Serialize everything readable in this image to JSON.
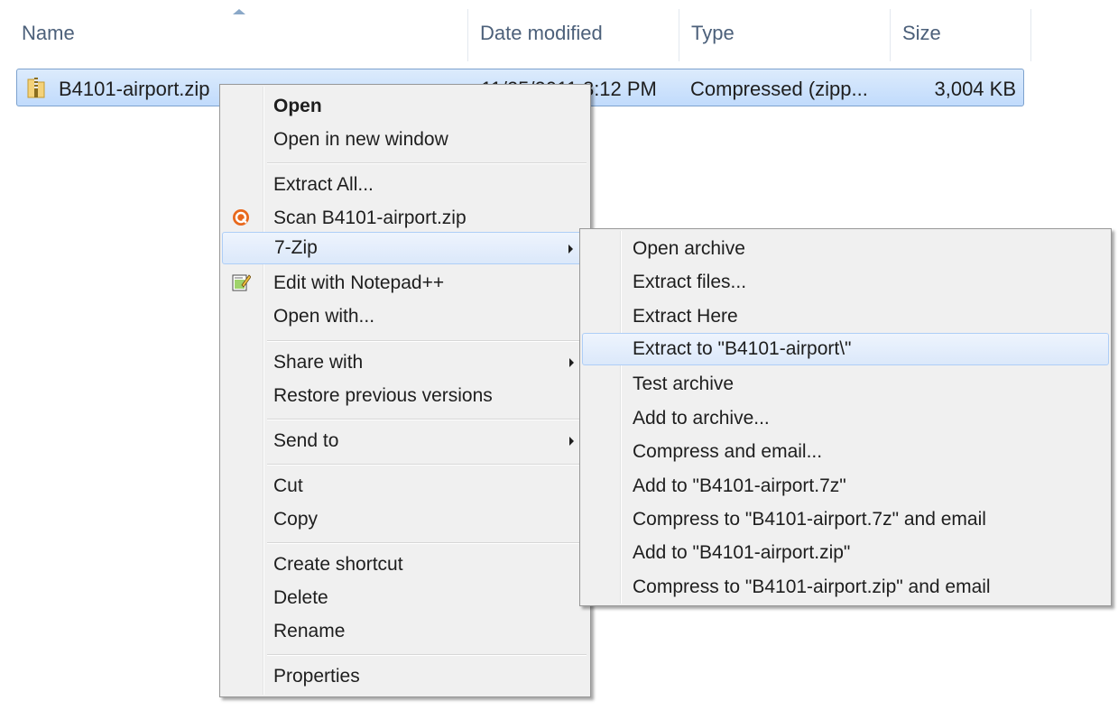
{
  "columns": {
    "name": "Name",
    "date_modified": "Date modified",
    "type": "Type",
    "size": "Size"
  },
  "file": {
    "name": "B4101-airport.zip",
    "date_modified": "11/25/2011 3:12 PM",
    "type": "Compressed (zipp...",
    "size": "3,004 KB",
    "icon": "zip-folder-icon"
  },
  "context_menu": {
    "open": "Open",
    "open_new_window": "Open in new window",
    "extract_all": "Extract All...",
    "scan": "Scan B4101-airport.zip",
    "seven_zip": "7-Zip",
    "edit_notepad": "Edit with Notepad++",
    "open_with": "Open with...",
    "share_with": "Share with",
    "restore_previous": "Restore previous versions",
    "send_to": "Send to",
    "cut": "Cut",
    "copy": "Copy",
    "create_shortcut": "Create shortcut",
    "delete": "Delete",
    "rename": "Rename",
    "properties": "Properties"
  },
  "seven_zip_menu": {
    "open_archive": "Open archive",
    "extract_files": "Extract files...",
    "extract_here": "Extract Here",
    "extract_to": "Extract to \"B4101-airport\\\"",
    "test_archive": "Test archive",
    "add_to_archive": "Add to archive...",
    "compress_email": "Compress and email...",
    "add_7z": "Add to \"B4101-airport.7z\"",
    "compress_7z_email": "Compress to \"B4101-airport.7z\" and email",
    "add_zip": "Add to \"B4101-airport.zip\"",
    "compress_zip_email": "Compress to \"B4101-airport.zip\" and email"
  },
  "colors": {
    "selection_border": "#7da2ce",
    "menu_bg": "#f0f0f0",
    "highlight_border": "#aecef7"
  }
}
